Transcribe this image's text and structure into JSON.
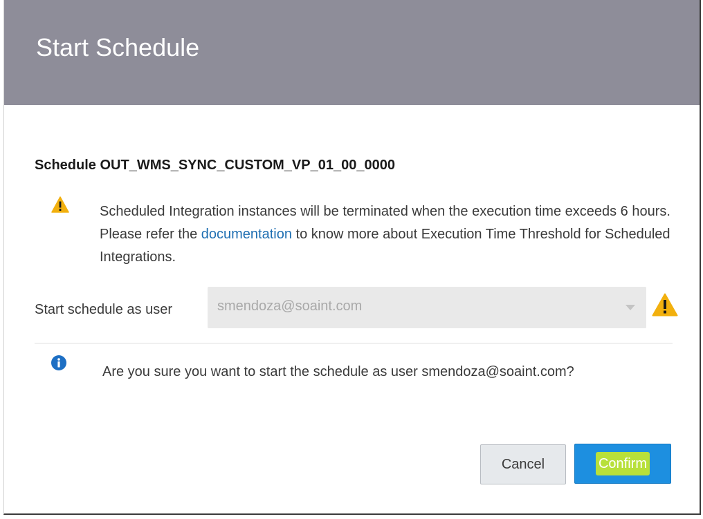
{
  "dialog": {
    "title": "Start Schedule",
    "schedule_name": "Schedule OUT_WMS_SYNC_CUSTOM_VP_01_00_0000"
  },
  "warning": {
    "icon": "warning-icon",
    "text_before": "Scheduled Integration instances will be terminated when the execution time exceeds 6 hours. Please refer the ",
    "link_text": "documentation",
    "text_after": " to know more about Execution Time Threshold for Scheduled Integrations."
  },
  "user_field": {
    "label": "Start schedule as user",
    "value": "smendoza@soaint.com",
    "warning_icon": "warning-icon"
  },
  "info": {
    "icon": "info-icon",
    "text": "Are you sure you want to start the schedule as user smendoza@soaint.com?"
  },
  "buttons": {
    "cancel": "Cancel",
    "confirm": "Confirm"
  },
  "colors": {
    "header_bg": "#8e8d99",
    "warning": "#f2b00e",
    "info": "#1d6fc4",
    "link": "#1f6fb2",
    "confirm_bg": "#1d8fe0",
    "highlight": "#b8e03a"
  }
}
